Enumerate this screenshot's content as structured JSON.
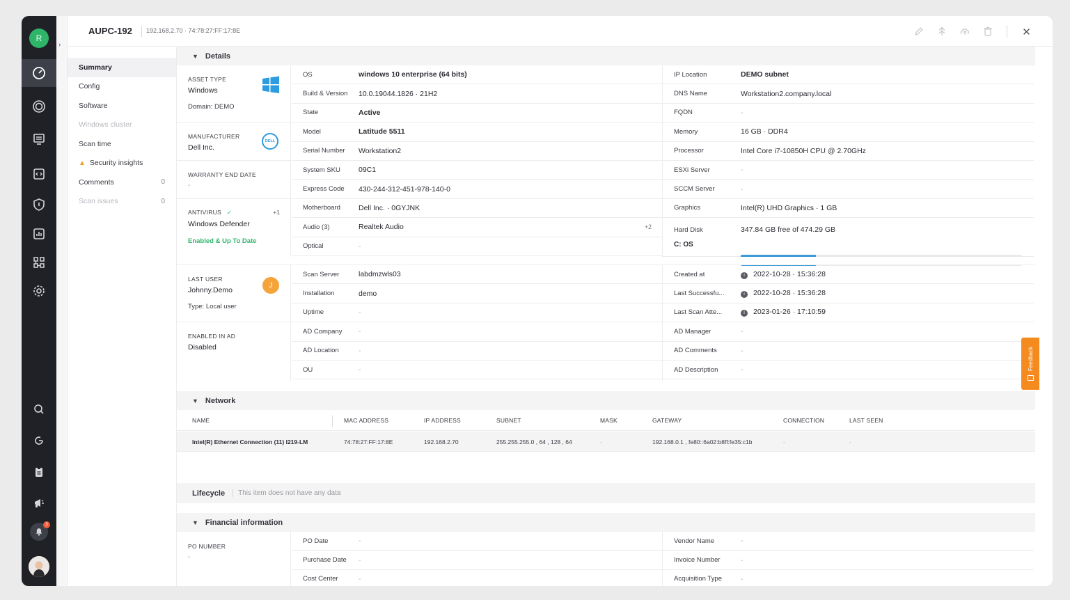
{
  "rail": {
    "avatar_initial": "R",
    "icons": [
      "dashboard-icon",
      "scan-icon",
      "monitor-icon",
      "code-icon",
      "shield-icon",
      "report-icon",
      "network-icon",
      "settings-icon",
      "search-icon",
      "refresh-icon",
      "clipboard-icon",
      "megaphone-icon",
      "bell-icon"
    ],
    "notification_badge": "3"
  },
  "header": {
    "title": "AUPC-192",
    "subtitle": "192.168.2.70 · 74:78:27:FF:17:8E"
  },
  "nav": [
    {
      "label": "Summary",
      "count": "",
      "state": "active"
    },
    {
      "label": "Config",
      "count": "",
      "state": "normal"
    },
    {
      "label": "Software",
      "count": "",
      "state": "normal"
    },
    {
      "label": "Windows cluster",
      "count": "",
      "state": "disabled"
    },
    {
      "label": "Scan time",
      "count": "",
      "state": "normal"
    },
    {
      "label": "Security insights",
      "count": "",
      "state": "warning"
    },
    {
      "label": "Comments",
      "count": "0",
      "state": "normal"
    },
    {
      "label": "Scan issues",
      "count": "0",
      "state": "disabled"
    }
  ],
  "details": {
    "title": "Details",
    "asset_type_label": "ASSET TYPE",
    "asset_type": "Windows",
    "domain": "Domain: DEMO",
    "manufacturer_label": "MANUFACTURER",
    "manufacturer": "Dell Inc.",
    "manufacturer_logo": "DELL",
    "warranty_label": "WARRANTY END DATE",
    "warranty": "-",
    "antivirus_label": "ANTIVIRUS",
    "antivirus_extra": "+1",
    "antivirus": "Windows Defender",
    "antivirus_status": "Enabled & Up To Date",
    "last_user_label": "LAST USER",
    "last_user": "Johnny.Demo",
    "last_user_initial": "J",
    "user_type": "Type: Local user",
    "enabled_ad_label": "ENABLED IN AD",
    "enabled_ad": "Disabled",
    "col1": [
      {
        "k": "OS",
        "v": "windows 10 enterprise (64 bits)",
        "bold": true
      },
      {
        "k": "Build & Version",
        "v": "10.0.19044.1826 · 21H2"
      },
      {
        "k": "State",
        "v": "Active",
        "bold": true
      },
      {
        "k": "Model",
        "v": "Latitude 5511",
        "bold": true
      },
      {
        "k": "Serial Number",
        "v": "Workstation2"
      },
      {
        "k": "System SKU",
        "v": "09C1"
      },
      {
        "k": "Express Code",
        "v": "430-244-312-451-978-140-0"
      },
      {
        "k": "Motherboard",
        "v": "Dell Inc. · 0GYJNK"
      },
      {
        "k": "Audio (3)",
        "v": "Realtek Audio",
        "extra": "+2"
      },
      {
        "k": "Optical",
        "v": "-"
      }
    ],
    "col2": [
      {
        "k": "IP Location",
        "v": "DEMO subnet",
        "bold": true
      },
      {
        "k": "DNS Name",
        "v": "Workstation2.company.local"
      },
      {
        "k": "FQDN",
        "v": "-"
      },
      {
        "k": "Memory",
        "v": "16 GB · DDR4"
      },
      {
        "k": "Processor",
        "v": "Intel Core i7-10850H CPU @ 2.70GHz"
      },
      {
        "k": "ESXi Server",
        "v": "-"
      },
      {
        "k": "SCCM Server",
        "v": "-"
      },
      {
        "k": "Graphics",
        "v": "Intel(R) UHD Graphics · 1 GB"
      }
    ],
    "hard_disk_label": "Hard Disk",
    "hard_disk": "347.84 GB free of 474.29 GB",
    "disk_drive": "C: OS",
    "disk_used_fraction": 0.267,
    "col1b": [
      {
        "k": "Scan Server",
        "v": "labdmzwls03"
      },
      {
        "k": "Installation",
        "v": "demo"
      },
      {
        "k": "Uptime",
        "v": "-"
      },
      {
        "k": "AD Company",
        "v": "-"
      },
      {
        "k": "AD Location",
        "v": "-"
      },
      {
        "k": "OU",
        "v": "-"
      }
    ],
    "col2b": [
      {
        "k": "Created at",
        "v": "2022-10-28 · 15:36:28",
        "info": true
      },
      {
        "k": "Last Successfu...",
        "v": "2022-10-28 · 15:36:28",
        "info": true
      },
      {
        "k": "Last Scan Atte...",
        "v": "2023-01-26 · 17:10:59",
        "info": true
      },
      {
        "k": "AD Manager",
        "v": "-"
      },
      {
        "k": "AD Comments",
        "v": "-"
      },
      {
        "k": "AD Description",
        "v": "-"
      }
    ]
  },
  "network": {
    "title": "Network",
    "columns": [
      "NAME",
      "MAC ADDRESS",
      "IP ADDRESS",
      "SUBNET",
      "MASK",
      "GATEWAY",
      "CONNECTION",
      "LAST SEEN"
    ],
    "row": [
      "Intel(R) Ethernet Connection (11) I219-LM",
      "74:78:27:FF:17:8E",
      "192.168.2.70",
      "255.255.255.0 , 64 , 128 , 64",
      "-",
      "192.168.0.1 , fe80::6a02:b8ff:fe35:c1b",
      "-",
      "-"
    ]
  },
  "lifecycle": {
    "title": "Lifecycle",
    "empty": "This item does not have any data"
  },
  "financial": {
    "title": "Financial information",
    "po_label": "PO NUMBER",
    "po_value": "-",
    "col1": [
      {
        "k": "PO Date",
        "v": "-"
      },
      {
        "k": "Purchase Date",
        "v": "-"
      },
      {
        "k": "Cost Center",
        "v": "-"
      }
    ],
    "col2": [
      {
        "k": "Vendor Name",
        "v": "-"
      },
      {
        "k": "Invoice Number",
        "v": "-"
      },
      {
        "k": "Acquisition Type",
        "v": "-"
      }
    ]
  },
  "feedback_label": "Feedback",
  "colors": {
    "accent": "#2fb56a",
    "rail": "#1f2127",
    "disk_fill": "#3c9ad8",
    "feedback": "#f58a1f",
    "warning": "#f0a02b"
  }
}
